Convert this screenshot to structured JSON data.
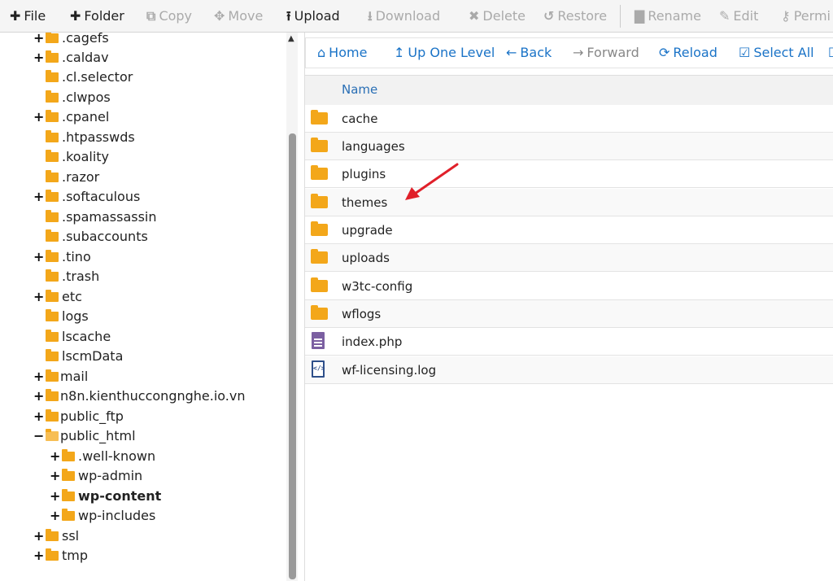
{
  "toolbar": {
    "file": "File",
    "folder": "Folder",
    "copy": "Copy",
    "move": "Move",
    "upload": "Upload",
    "download": "Download",
    "delete": "Delete",
    "restore": "Restore",
    "rename": "Rename",
    "edit": "Edit",
    "permissions": "Permi"
  },
  "tree": {
    "items": [
      {
        "label": ".cagefs",
        "toggle": "+"
      },
      {
        "label": ".caldav",
        "toggle": "+"
      },
      {
        "label": ".cl.selector",
        "toggle": ""
      },
      {
        "label": ".clwpos",
        "toggle": ""
      },
      {
        "label": ".cpanel",
        "toggle": "+"
      },
      {
        "label": ".htpasswds",
        "toggle": ""
      },
      {
        "label": ".koality",
        "toggle": ""
      },
      {
        "label": ".razor",
        "toggle": ""
      },
      {
        "label": ".softaculous",
        "toggle": "+"
      },
      {
        "label": ".spamassassin",
        "toggle": ""
      },
      {
        "label": ".subaccounts",
        "toggle": ""
      },
      {
        "label": ".tino",
        "toggle": "+"
      },
      {
        "label": ".trash",
        "toggle": ""
      },
      {
        "label": "etc",
        "toggle": "+"
      },
      {
        "label": "logs",
        "toggle": ""
      },
      {
        "label": "lscache",
        "toggle": ""
      },
      {
        "label": "lscmData",
        "toggle": ""
      },
      {
        "label": "mail",
        "toggle": "+"
      },
      {
        "label": "n8n.kienthuccongnghe.io.vn",
        "toggle": "+"
      },
      {
        "label": "public_ftp",
        "toggle": "+"
      },
      {
        "label": "public_html",
        "toggle": "−"
      },
      {
        "label": ".well-known",
        "toggle": "+"
      },
      {
        "label": "wp-admin",
        "toggle": "+"
      },
      {
        "label": "wp-content",
        "toggle": "+"
      },
      {
        "label": "wp-includes",
        "toggle": "+"
      },
      {
        "label": "ssl",
        "toggle": "+"
      },
      {
        "label": "tmp",
        "toggle": "+"
      }
    ]
  },
  "nav": {
    "home": "Home",
    "up": "Up One Level",
    "back": "Back",
    "forward": "Forward",
    "reload": "Reload",
    "select_all": "Select All"
  },
  "list": {
    "header": "Name",
    "files": [
      {
        "name": "cache",
        "icon": "folder-icon"
      },
      {
        "name": "languages",
        "icon": "folder-icon"
      },
      {
        "name": "plugins",
        "icon": "folder-icon"
      },
      {
        "name": "themes",
        "icon": "folder-icon"
      },
      {
        "name": "upgrade",
        "icon": "folder-icon"
      },
      {
        "name": "uploads",
        "icon": "folder-icon"
      },
      {
        "name": "w3tc-config",
        "icon": "folder-icon"
      },
      {
        "name": "wflogs",
        "icon": "folder-icon"
      },
      {
        "name": "index.php",
        "icon": "text-file-icon"
      },
      {
        "name": "wf-licensing.log",
        "icon": "code-file-icon"
      }
    ]
  },
  "colors": {
    "folder": "#f3a71a",
    "link": "#1a73c7",
    "annotation_arrow": "#e0202a"
  }
}
